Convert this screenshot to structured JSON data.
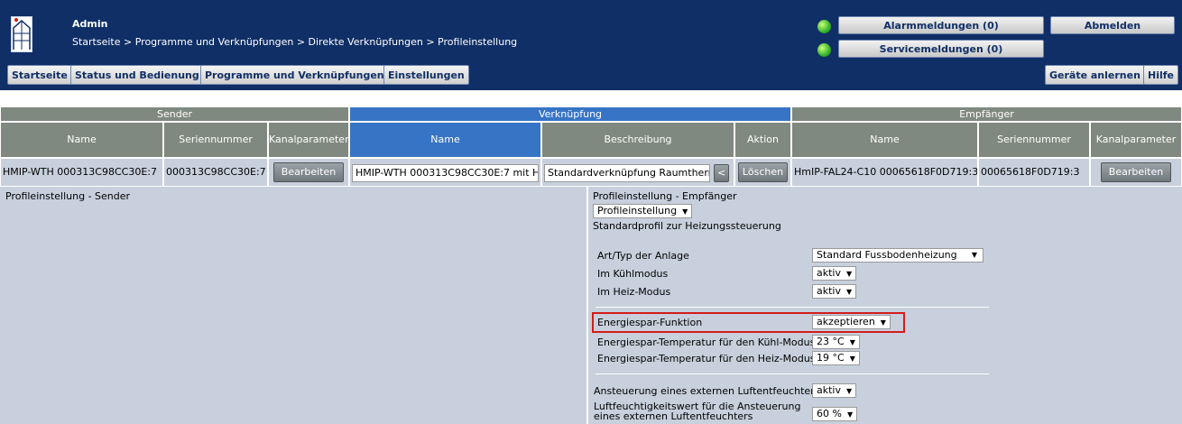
{
  "header": {
    "user": "Admin",
    "breadcrumb": "Startseite > Programme und Verknüpfungen > Direkte Verknüpfungen > Profileinstellung",
    "alarm_button": "Alarmmeldungen (0)",
    "service_button": "Servicemeldungen (0)",
    "logout_button": "Abmelden",
    "status_led_color": "#35b22b"
  },
  "nav": {
    "items": [
      "Startseite",
      "Status und Bedienung",
      "Programme und Verknüpfungen",
      "Einstellungen"
    ],
    "teach_in": "Geräte anlernen",
    "help": "Hilfe"
  },
  "table": {
    "groups": {
      "sender": "Sender",
      "link": "Verknüpfung",
      "receiver": "Empfänger"
    },
    "columns": {
      "sender_name": "Name",
      "sender_serial": "Seriennummer",
      "sender_channel": "Kanalparameter",
      "link_name": "Name",
      "link_desc": "Beschreibung",
      "link_action": "Aktion",
      "recv_name": "Name",
      "recv_serial": "Seriennummer",
      "recv_channel": "Kanalparameter"
    },
    "row": {
      "sender_name": "HMIP-WTH 000313C98CC30E:7",
      "sender_serial": "000313C98CC30E:7",
      "sender_edit": "Bearbeiten",
      "link_name_value": "HMIP-WTH 000313C98CC30E:7 mit H",
      "link_desc_value": "Standardverknüpfung Raumtherm",
      "link_desc_more": "<",
      "delete": "Löschen",
      "recv_name": "HmIP-FAL24-C10 00065618F0D719:3",
      "recv_serial": "00065618F0D719:3",
      "recv_edit": "Bearbeiten"
    }
  },
  "sender_panel": {
    "title": "Profileinstellung - Sender"
  },
  "receiver_panel": {
    "title": "Profileinstellung - Empfänger",
    "profile_select": "Profileinstellung",
    "profile_desc": "Standardprofil zur Heizungssteuerung",
    "settings": [
      {
        "label": "Art/Typ der Anlage",
        "value": "Standard Fussbodenheizung"
      },
      {
        "label": "Im Kühlmodus",
        "value": "aktiv"
      },
      {
        "label": "Im Heiz-Modus",
        "value": "aktiv"
      },
      {
        "label": "Energiespar-Funktion",
        "value": "akzeptieren"
      },
      {
        "label": "Energiespar-Temperatur für den Kühl-Modus",
        "value": "23 °C"
      },
      {
        "label": "Energiespar-Temperatur für den Heiz-Modus",
        "value": "19 °C"
      },
      {
        "label": "Ansteuerung eines externen Luftentfeuchters",
        "value": "aktiv"
      },
      {
        "label_line1": "Luftfeuchtigkeitswert für die Ansteuerung",
        "label_line2": "eines externen Luftentfeuchters",
        "value": "60 %"
      }
    ],
    "highlight_color": "#d31c1c"
  }
}
